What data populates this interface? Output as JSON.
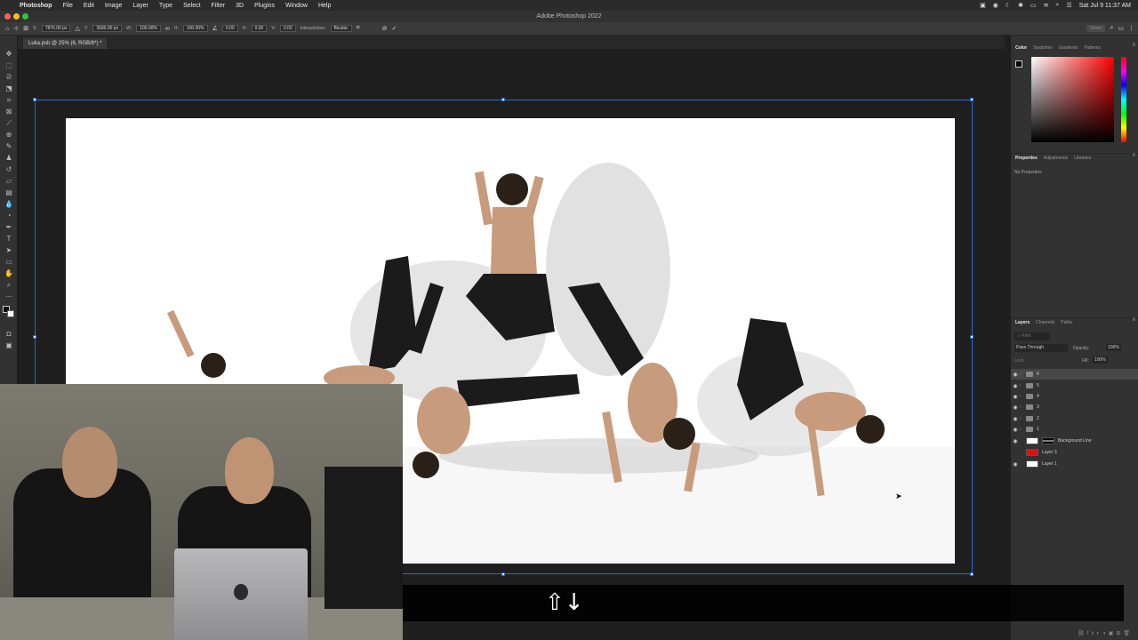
{
  "menubar": {
    "app_name": "Photoshop",
    "items": [
      "File",
      "Edit",
      "Image",
      "Layer",
      "Type",
      "Select",
      "Filter",
      "3D",
      "Plugins",
      "Window",
      "Help"
    ],
    "clock": "Sat Jul 9  11:37 AM"
  },
  "window": {
    "title": "Adobe Photoshop 2022"
  },
  "options": {
    "x_label": "X:",
    "x_value": "7876.00 px",
    "y_label": "Y:",
    "y_value": "3930.00 px",
    "w_label": "W:",
    "w_value": "100.00%",
    "h_label": "H:",
    "h_value": "100.00%",
    "angle_value": "0.00",
    "h_skew_label": "H:",
    "h_skew_value": "0.00",
    "v_skew_label": "V:",
    "v_skew_value": "0.00",
    "interpolation_label": "Interpolation:",
    "interpolation_value": "Bicubic",
    "share_label": "Share"
  },
  "document": {
    "tab_title": "Luka.psb @ 25% (6, RGB/8*) *"
  },
  "color_panel": {
    "tabs": [
      "Color",
      "Swatches",
      "Gradients",
      "Patterns"
    ],
    "foreground": "#000000",
    "background": "#ffffff",
    "hue": "#ff0000"
  },
  "properties_panel": {
    "tabs": [
      "Properties",
      "Adjustments",
      "Libraries"
    ],
    "empty_text": "No Properties"
  },
  "layers_panel": {
    "tabs": [
      "Layers",
      "Channels",
      "Paths"
    ],
    "filter_placeholder": "Kind",
    "blend_mode": "Pass Through",
    "opacity_label": "Opacity:",
    "opacity_value": "100%",
    "lock_label": "Lock:",
    "fill_label": "Fill:",
    "fill_value": "100%",
    "layers": [
      {
        "name": "6",
        "type": "group",
        "selected": true
      },
      {
        "name": "5",
        "type": "group"
      },
      {
        "name": "4",
        "type": "group"
      },
      {
        "name": "3",
        "type": "group"
      },
      {
        "name": "2",
        "type": "group"
      },
      {
        "name": "1",
        "type": "group"
      },
      {
        "name": "Background Line",
        "type": "masked"
      },
      {
        "name": "Layer 3",
        "type": "red-fill"
      },
      {
        "name": "Layer 1",
        "type": "white-fill"
      }
    ]
  },
  "caption": {
    "keys": "⇧↓"
  }
}
